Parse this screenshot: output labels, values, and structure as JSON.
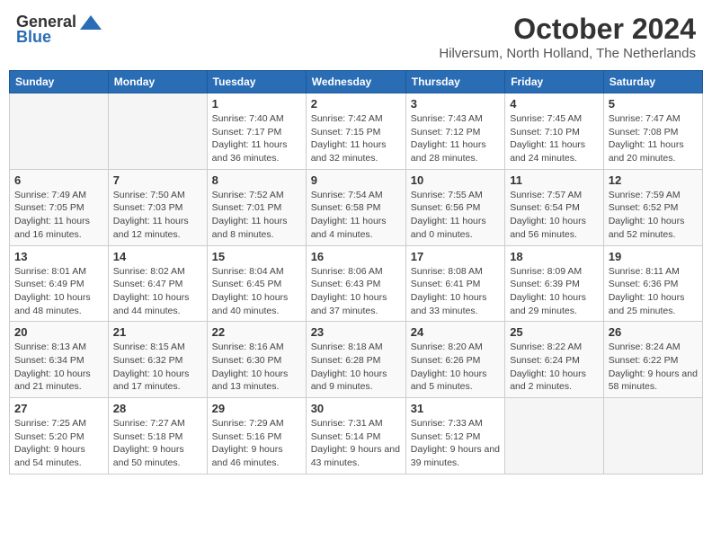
{
  "header": {
    "logo_general": "General",
    "logo_blue": "Blue",
    "month": "October 2024",
    "location": "Hilversum, North Holland, The Netherlands"
  },
  "days_of_week": [
    "Sunday",
    "Monday",
    "Tuesday",
    "Wednesday",
    "Thursday",
    "Friday",
    "Saturday"
  ],
  "weeks": [
    [
      {
        "day": "",
        "sunrise": "",
        "sunset": "",
        "daylight": ""
      },
      {
        "day": "",
        "sunrise": "",
        "sunset": "",
        "daylight": ""
      },
      {
        "day": "1",
        "sunrise": "Sunrise: 7:40 AM",
        "sunset": "Sunset: 7:17 PM",
        "daylight": "Daylight: 11 hours and 36 minutes."
      },
      {
        "day": "2",
        "sunrise": "Sunrise: 7:42 AM",
        "sunset": "Sunset: 7:15 PM",
        "daylight": "Daylight: 11 hours and 32 minutes."
      },
      {
        "day": "3",
        "sunrise": "Sunrise: 7:43 AM",
        "sunset": "Sunset: 7:12 PM",
        "daylight": "Daylight: 11 hours and 28 minutes."
      },
      {
        "day": "4",
        "sunrise": "Sunrise: 7:45 AM",
        "sunset": "Sunset: 7:10 PM",
        "daylight": "Daylight: 11 hours and 24 minutes."
      },
      {
        "day": "5",
        "sunrise": "Sunrise: 7:47 AM",
        "sunset": "Sunset: 7:08 PM",
        "daylight": "Daylight: 11 hours and 20 minutes."
      }
    ],
    [
      {
        "day": "6",
        "sunrise": "Sunrise: 7:49 AM",
        "sunset": "Sunset: 7:05 PM",
        "daylight": "Daylight: 11 hours and 16 minutes."
      },
      {
        "day": "7",
        "sunrise": "Sunrise: 7:50 AM",
        "sunset": "Sunset: 7:03 PM",
        "daylight": "Daylight: 11 hours and 12 minutes."
      },
      {
        "day": "8",
        "sunrise": "Sunrise: 7:52 AM",
        "sunset": "Sunset: 7:01 PM",
        "daylight": "Daylight: 11 hours and 8 minutes."
      },
      {
        "day": "9",
        "sunrise": "Sunrise: 7:54 AM",
        "sunset": "Sunset: 6:58 PM",
        "daylight": "Daylight: 11 hours and 4 minutes."
      },
      {
        "day": "10",
        "sunrise": "Sunrise: 7:55 AM",
        "sunset": "Sunset: 6:56 PM",
        "daylight": "Daylight: 11 hours and 0 minutes."
      },
      {
        "day": "11",
        "sunrise": "Sunrise: 7:57 AM",
        "sunset": "Sunset: 6:54 PM",
        "daylight": "Daylight: 10 hours and 56 minutes."
      },
      {
        "day": "12",
        "sunrise": "Sunrise: 7:59 AM",
        "sunset": "Sunset: 6:52 PM",
        "daylight": "Daylight: 10 hours and 52 minutes."
      }
    ],
    [
      {
        "day": "13",
        "sunrise": "Sunrise: 8:01 AM",
        "sunset": "Sunset: 6:49 PM",
        "daylight": "Daylight: 10 hours and 48 minutes."
      },
      {
        "day": "14",
        "sunrise": "Sunrise: 8:02 AM",
        "sunset": "Sunset: 6:47 PM",
        "daylight": "Daylight: 10 hours and 44 minutes."
      },
      {
        "day": "15",
        "sunrise": "Sunrise: 8:04 AM",
        "sunset": "Sunset: 6:45 PM",
        "daylight": "Daylight: 10 hours and 40 minutes."
      },
      {
        "day": "16",
        "sunrise": "Sunrise: 8:06 AM",
        "sunset": "Sunset: 6:43 PM",
        "daylight": "Daylight: 10 hours and 37 minutes."
      },
      {
        "day": "17",
        "sunrise": "Sunrise: 8:08 AM",
        "sunset": "Sunset: 6:41 PM",
        "daylight": "Daylight: 10 hours and 33 minutes."
      },
      {
        "day": "18",
        "sunrise": "Sunrise: 8:09 AM",
        "sunset": "Sunset: 6:39 PM",
        "daylight": "Daylight: 10 hours and 29 minutes."
      },
      {
        "day": "19",
        "sunrise": "Sunrise: 8:11 AM",
        "sunset": "Sunset: 6:36 PM",
        "daylight": "Daylight: 10 hours and 25 minutes."
      }
    ],
    [
      {
        "day": "20",
        "sunrise": "Sunrise: 8:13 AM",
        "sunset": "Sunset: 6:34 PM",
        "daylight": "Daylight: 10 hours and 21 minutes."
      },
      {
        "day": "21",
        "sunrise": "Sunrise: 8:15 AM",
        "sunset": "Sunset: 6:32 PM",
        "daylight": "Daylight: 10 hours and 17 minutes."
      },
      {
        "day": "22",
        "sunrise": "Sunrise: 8:16 AM",
        "sunset": "Sunset: 6:30 PM",
        "daylight": "Daylight: 10 hours and 13 minutes."
      },
      {
        "day": "23",
        "sunrise": "Sunrise: 8:18 AM",
        "sunset": "Sunset: 6:28 PM",
        "daylight": "Daylight: 10 hours and 9 minutes."
      },
      {
        "day": "24",
        "sunrise": "Sunrise: 8:20 AM",
        "sunset": "Sunset: 6:26 PM",
        "daylight": "Daylight: 10 hours and 5 minutes."
      },
      {
        "day": "25",
        "sunrise": "Sunrise: 8:22 AM",
        "sunset": "Sunset: 6:24 PM",
        "daylight": "Daylight: 10 hours and 2 minutes."
      },
      {
        "day": "26",
        "sunrise": "Sunrise: 8:24 AM",
        "sunset": "Sunset: 6:22 PM",
        "daylight": "Daylight: 9 hours and 58 minutes."
      }
    ],
    [
      {
        "day": "27",
        "sunrise": "Sunrise: 7:25 AM",
        "sunset": "Sunset: 5:20 PM",
        "daylight": "Daylight: 9 hours and 54 minutes."
      },
      {
        "day": "28",
        "sunrise": "Sunrise: 7:27 AM",
        "sunset": "Sunset: 5:18 PM",
        "daylight": "Daylight: 9 hours and 50 minutes."
      },
      {
        "day": "29",
        "sunrise": "Sunrise: 7:29 AM",
        "sunset": "Sunset: 5:16 PM",
        "daylight": "Daylight: 9 hours and 46 minutes."
      },
      {
        "day": "30",
        "sunrise": "Sunrise: 7:31 AM",
        "sunset": "Sunset: 5:14 PM",
        "daylight": "Daylight: 9 hours and 43 minutes."
      },
      {
        "day": "31",
        "sunrise": "Sunrise: 7:33 AM",
        "sunset": "Sunset: 5:12 PM",
        "daylight": "Daylight: 9 hours and 39 minutes."
      },
      {
        "day": "",
        "sunrise": "",
        "sunset": "",
        "daylight": ""
      },
      {
        "day": "",
        "sunrise": "",
        "sunset": "",
        "daylight": ""
      }
    ]
  ]
}
